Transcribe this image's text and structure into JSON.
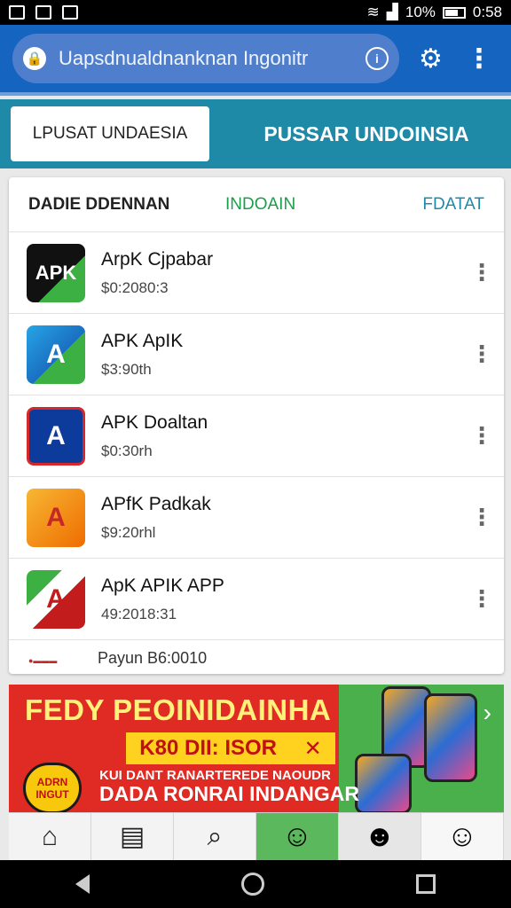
{
  "status_bar": {
    "battery_text": "10%",
    "time": "0:58"
  },
  "browser": {
    "url": "Uapsdnualdnanknan Ingonitr",
    "icons": [
      "lock-icon",
      "info-icon",
      "gear-icon",
      "more-vert-icon"
    ]
  },
  "tabs": {
    "left": "LPUSAT UNDAESIA",
    "right": "PUSSAR UNDOINSIA"
  },
  "list_card": {
    "header": {
      "col1": "DADIE DDENNAN",
      "col2": "INDOAIN",
      "col3": "FDATAT"
    },
    "items": [
      {
        "title": "ArpK Cjpabar",
        "subtitle": "$0:2080:3",
        "icon_letter": "APK",
        "icon_color": "#111111"
      },
      {
        "title": "APK ApIK",
        "subtitle": "$3:90th",
        "icon_letter": "A",
        "icon_color": "#1d8fd8"
      },
      {
        "title": "APK Doaltan",
        "subtitle": "$0:30rh",
        "icon_letter": "A",
        "icon_color": "#0d3b9c"
      },
      {
        "title": "APfK Padkak",
        "subtitle": "$9:20rhl",
        "icon_letter": "A",
        "icon_color": "#f39a12"
      },
      {
        "title": "ApK APIK APP",
        "subtitle": "49:2018:31",
        "icon_letter": "A",
        "icon_color": "#c21c1c"
      }
    ],
    "footer": "Payun B6:0010"
  },
  "banner": {
    "title": "FEDY PEOINIDAINHA",
    "highlight": "K80 DII: ISOR",
    "highlight_mark": "✕",
    "line1": "KUI DANT RANARTEREDE NAOUDR",
    "line2": "DADA RONRAI INDANGAR",
    "badge": "ADRN INGUT"
  },
  "colors": {
    "toolbar": "#1565c0",
    "tab_bar": "#1e8aa8",
    "banner_red": "#e02b24",
    "green_accent": "#1b9e4b"
  }
}
